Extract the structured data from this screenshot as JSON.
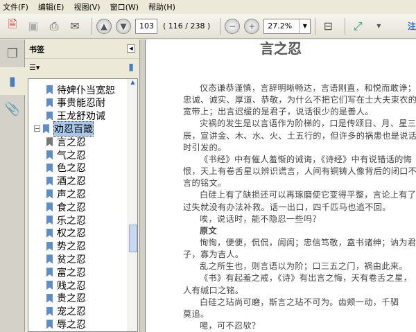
{
  "menu": [
    "文件(F)",
    "编辑(E)",
    "视图(V)",
    "窗口(W)",
    "帮助(H)"
  ],
  "toolbar": {
    "page": "103",
    "page_info": "( 116 / 238 )",
    "zoom": "27.2%",
    "annot": "注"
  },
  "panel": {
    "title": "书签"
  },
  "bookmarks": [
    {
      "label": "待婢仆当宽恕"
    },
    {
      "label": "事贵能忍耐"
    },
    {
      "label": "王龙舒劝诫"
    },
    {
      "label": "劝忍百箴",
      "selected": true,
      "expanded": true
    },
    {
      "label": "言之忍",
      "current": true
    },
    {
      "label": "气之忍"
    },
    {
      "label": "色之忍"
    },
    {
      "label": "酒之忍"
    },
    {
      "label": "声之忍"
    },
    {
      "label": "食之忍"
    },
    {
      "label": "乐之忍"
    },
    {
      "label": "权之忍"
    },
    {
      "label": "势之忍"
    },
    {
      "label": "贫之忍"
    },
    {
      "label": "富之忍"
    },
    {
      "label": "贱之忍"
    },
    {
      "label": "贵之忍"
    },
    {
      "label": "宠之忍"
    },
    {
      "label": "辱之忍"
    }
  ],
  "doc": {
    "title": "言之忍",
    "lines": [
      {
        "t": "仪态谦恭谨慎，言辞明晰畅达，言语刚直，和悦而敢诤；",
        "i": 1
      },
      {
        "t": "忠诚、诚实、厚道、恭敬，为什么不把它们写在士大夫束衣的",
        "i": 0
      },
      {
        "t": "宽带上；出言迟缓的是君子，说话很少的是善人。",
        "i": 0
      },
      {
        "t": "灾祸的发生是以言语作为阶梯的，口是传颂日、月、星三",
        "i": 1
      },
      {
        "t": "辰，宣讲金、木、水、火、土五行的，但许多的祸患也是说话",
        "i": 0
      },
      {
        "t": "时引发的。",
        "i": 0
      },
      {
        "t": "《书经》中有催人羞惭的诫诲，《诗经》中有说错话的悔",
        "i": 1
      },
      {
        "t": "恨，天上有卷舌星以辨识谎言，人间有铜铸人像背后的闭口不",
        "i": 0
      },
      {
        "t": "言的铭文。",
        "i": 0
      },
      {
        "t": "白硅上有了缺损还可以再琢磨使它变得平整，言论上有了",
        "i": 1
      },
      {
        "t": "过失就没有办法补救。话一出口，四千匹马也追不回。",
        "i": 0
      },
      {
        "t": "唉，说话时，能不隐忍一些吗？",
        "i": 1
      },
      {
        "t": "原文",
        "i": 1,
        "b": 1
      },
      {
        "t": "恂恂，便便，侃侃，訚訚；忠信笃敬，盍书诸绅；讷为君",
        "i": 1
      },
      {
        "t": "子，寡为吉人。",
        "i": 0
      },
      {
        "t": "乱之所生也，则言语以为阶；口三五之门，祸由此来。",
        "i": 1
      },
      {
        "t": "《书》有起羞之戒，《诗》有出言之悔，天有卷舌之星，",
        "i": 1
      },
      {
        "t": "人有缄口之铭。",
        "i": 0
      },
      {
        "t": "白硅之玷尚可磨，斯言之玷不可为。齿颊一动，千驷",
        "i": 1
      },
      {
        "t": "莫追。",
        "i": 0
      },
      {
        "t": "噫，可不忍欤？",
        "i": 1
      }
    ]
  }
}
